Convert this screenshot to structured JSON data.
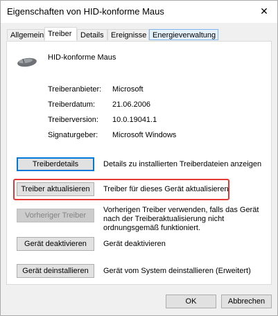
{
  "window": {
    "title": "Eigenschaften von HID-konforme Maus",
    "close_glyph": "✕"
  },
  "tabs": [
    "Allgemein",
    "Treiber",
    "Details",
    "Ereignisse",
    "Energieverwaltung"
  ],
  "active_tab": "Treiber",
  "device": {
    "name": "HID-konforme Maus",
    "icon": "mouse-icon"
  },
  "properties": [
    {
      "label": "Treiberanbieter:",
      "value": "Microsoft"
    },
    {
      "label": "Treiberdatum:",
      "value": "21.06.2006"
    },
    {
      "label": "Treiberversion:",
      "value": "10.0.19041.1"
    },
    {
      "label": "Signaturgeber:",
      "value": "Microsoft Windows"
    }
  ],
  "actions": [
    {
      "button": "Treiberdetails",
      "description": "Details zu installierten Treiberdateien anzeigen",
      "enabled": true
    },
    {
      "button": "Treiber aktualisieren",
      "description": "Treiber für dieses Gerät aktualisieren",
      "enabled": true,
      "highlighted": true
    },
    {
      "button": "Vorheriger Treiber",
      "description": "Vorherigen Treiber verwenden, falls das Gerät nach der Treiberaktualisierung nicht ordnungsgemäß funktioniert.",
      "enabled": false
    },
    {
      "button": "Gerät deaktivieren",
      "description": "Gerät deaktivieren",
      "enabled": true
    },
    {
      "button": "Gerät deinstallieren",
      "description": "Gerät vom System deinstallieren (Erweitert)",
      "enabled": true
    }
  ],
  "footer": {
    "ok": "OK",
    "cancel": "Abbrechen"
  },
  "colors": {
    "highlight": "#e53935",
    "focus_border": "#0078d7"
  }
}
